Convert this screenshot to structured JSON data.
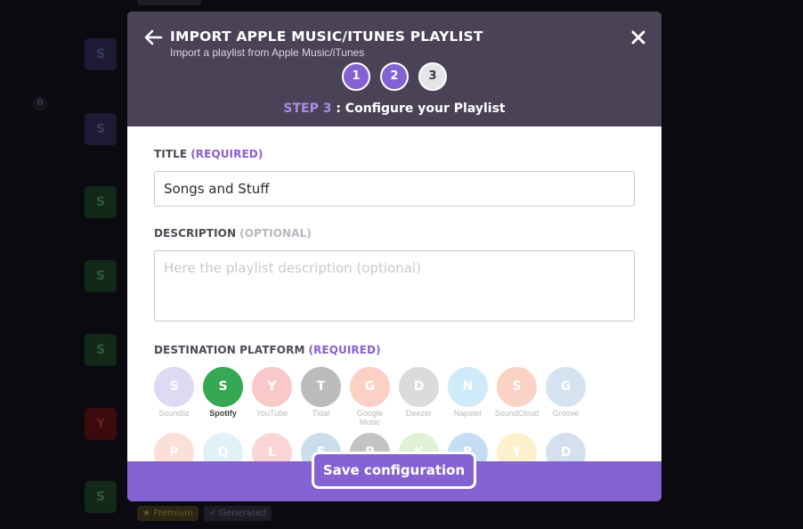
{
  "background": {
    "counter": "0",
    "tiles": [
      {
        "letter": "S",
        "platform": "soundiiz"
      },
      {
        "letter": "S",
        "platform": "soundiiz"
      },
      {
        "letter": "S",
        "platform": "spotify"
      },
      {
        "letter": "S",
        "platform": "spotify"
      },
      {
        "letter": "S",
        "platform": "spotify"
      },
      {
        "letter": "Y",
        "platform": "youtube"
      },
      {
        "letter": "S",
        "platform": "spotify"
      }
    ],
    "badges": {
      "premium": "★ Premium",
      "generated": "✓ Generated"
    }
  },
  "modal": {
    "title": "IMPORT APPLE MUSIC/ITUNES PLAYLIST",
    "subtitle": "Import a playlist from Apple Music/iTunes",
    "back_icon": "arrow-left-icon",
    "close_icon": "close-icon",
    "steps": [
      "1",
      "2",
      "3"
    ],
    "current_step": 3,
    "step_caption_prefix": "STEP 3",
    "step_caption_text": " : Configure your Playlist"
  },
  "form": {
    "title_label": "TITLE",
    "title_required": "(REQUIRED)",
    "title_value": "Songs and Stuff",
    "description_label": "DESCRIPTION",
    "description_optional": "(OPTIONAL)",
    "description_placeholder": "Here the playlist description (optional)",
    "destination_label": "DESTINATION PLATFORM",
    "destination_required": "(REQUIRED)"
  },
  "platforms": [
    {
      "letter": "S",
      "name": "Soundiiz",
      "color": "#a995dc",
      "selected": false
    },
    {
      "letter": "S",
      "name": "Spotify",
      "color": "#34a853",
      "selected": true
    },
    {
      "letter": "Y",
      "name": "YouTube",
      "color": "#f0636a",
      "selected": false
    },
    {
      "letter": "T",
      "name": "Tidal",
      "color": "#3f3f3f",
      "selected": false
    },
    {
      "letter": "G",
      "name": "Google Music",
      "color": "#f77c5b",
      "selected": false
    },
    {
      "letter": "D",
      "name": "Deezer",
      "color": "#9a9a9a",
      "selected": false
    },
    {
      "letter": "N",
      "name": "Napster",
      "color": "#78c8f0",
      "selected": false
    },
    {
      "letter": "S",
      "name": "SoundCloud",
      "color": "#f7805c",
      "selected": false
    },
    {
      "letter": "G",
      "name": "Groove",
      "color": "#8ab0d8",
      "selected": false
    },
    {
      "letter": "P",
      "name": "",
      "color": "#f7a890",
      "selected": false
    },
    {
      "letter": "Q",
      "name": "",
      "color": "#a8dcea",
      "selected": false
    },
    {
      "letter": "L",
      "name": "",
      "color": "#f28a8a",
      "selected": false
    },
    {
      "letter": "E",
      "name": "",
      "color": "#6aa0c8",
      "selected": false
    },
    {
      "letter": "P",
      "name": "",
      "color": "#555555",
      "selected": false
    },
    {
      "letter": "K",
      "name": "",
      "color": "#a8d890",
      "selected": false
    },
    {
      "letter": "B",
      "name": "",
      "color": "#5aa0e0",
      "selected": false
    },
    {
      "letter": "Y",
      "name": "",
      "color": "#f8d870",
      "selected": false
    },
    {
      "letter": "D",
      "name": "",
      "color": "#8aa8d0",
      "selected": false
    }
  ],
  "footer": {
    "save_label": "Save configuration"
  }
}
